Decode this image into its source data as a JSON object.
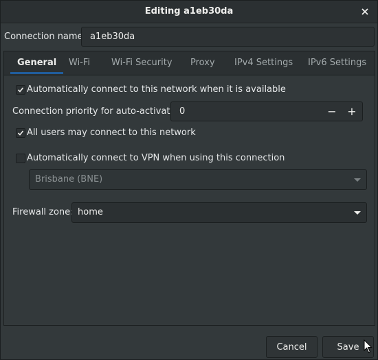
{
  "window": {
    "title": "Editing a1eb30da"
  },
  "connection": {
    "label": "Connection name:",
    "value": "a1eb30da"
  },
  "tabs": [
    {
      "label": "General",
      "active": true
    },
    {
      "label": "Wi-Fi",
      "active": false
    },
    {
      "label": "Wi-Fi Security",
      "active": false
    },
    {
      "label": "Proxy",
      "active": false
    },
    {
      "label": "IPv4 Settings",
      "active": false
    },
    {
      "label": "IPv6 Settings",
      "active": false
    }
  ],
  "general": {
    "auto_connect": {
      "label": "Automatically connect to this network when it is available",
      "checked": true
    },
    "priority": {
      "label": "Connection priority for auto-activation:",
      "value": "0",
      "minus": "−",
      "plus": "+"
    },
    "all_users": {
      "label": "All users may connect to this network",
      "checked": true
    },
    "vpn": {
      "label": "Automatically connect to VPN when using this connection",
      "checked": false
    },
    "vpn_select": {
      "value": "Brisbane (BNE)",
      "disabled": true
    },
    "firewall": {
      "label": "Firewall zone:",
      "value": "home"
    }
  },
  "buttons": {
    "cancel": "Cancel",
    "save": "Save"
  },
  "icons": {
    "close": "close-icon",
    "check": "check-icon",
    "dropdown": "chevron-down-icon",
    "cursor": "mouse-pointer-icon"
  },
  "colors": {
    "background": "#33393b",
    "titlebar": "#2b3032",
    "accent": "#215d9c",
    "text": "#e5e7e8"
  }
}
